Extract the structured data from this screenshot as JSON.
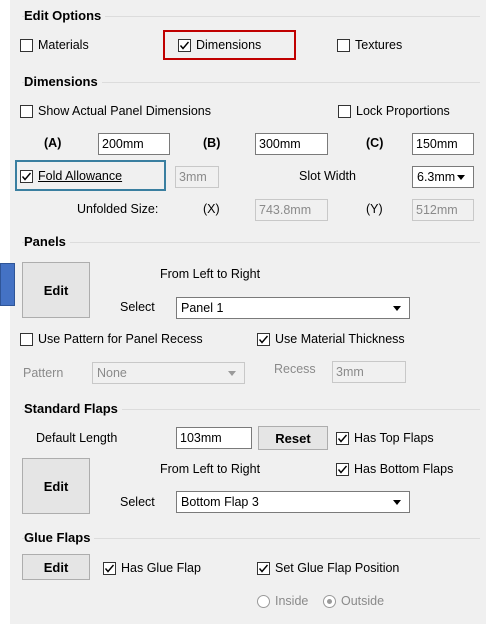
{
  "edit_options": {
    "header": "Edit Options",
    "materials_label": "Materials",
    "dimensions_label": "Dimensions",
    "textures_label": "Textures"
  },
  "dimensions": {
    "header": "Dimensions",
    "show_actual_label": "Show Actual Panel Dimensions",
    "lock_proportions_label": "Lock Proportions",
    "a_label": "(A)",
    "a_value": "200mm",
    "b_label": "(B)",
    "b_value": "300mm",
    "c_label": "(C)",
    "c_value": "150mm",
    "fold_allowance_label": "Fold Allowance",
    "fold_allowance_value": "3mm",
    "slot_width_label": "Slot Width",
    "slot_width_value": "6.3mm",
    "unfolded_size_label": "Unfolded Size:",
    "x_label": "(X)",
    "x_value": "743.8mm",
    "y_label": "(Y)",
    "y_value": "512mm"
  },
  "panels": {
    "header": "Panels",
    "edit_label": "Edit",
    "from_left_label": "From Left to Right",
    "select_label": "Select",
    "select_value": "Panel 1",
    "use_pattern_label": "Use Pattern for Panel Recess",
    "use_material_thickness_label": "Use Material Thickness",
    "pattern_label": "Pattern",
    "pattern_value": "None",
    "recess_label": "Recess",
    "recess_value": "3mm"
  },
  "standard_flaps": {
    "header": "Standard Flaps",
    "default_length_label": "Default Length",
    "default_length_value": "103mm",
    "reset_label": "Reset",
    "has_top_label": "Has Top Flaps",
    "from_left_label": "From Left to Right",
    "has_bottom_label": "Has Bottom Flaps",
    "edit_label": "Edit",
    "select_label": "Select",
    "select_value": "Bottom Flap 3"
  },
  "glue_flaps": {
    "header": "Glue Flaps",
    "edit_label": "Edit",
    "has_glue_label": "Has Glue Flap",
    "set_position_label": "Set Glue Flap Position",
    "inside_label": "Inside",
    "outside_label": "Outside"
  },
  "colors": {
    "highlight_red": "#c00000",
    "highlight_teal": "#3a7fa0",
    "marker_blue": "#4472c4"
  }
}
